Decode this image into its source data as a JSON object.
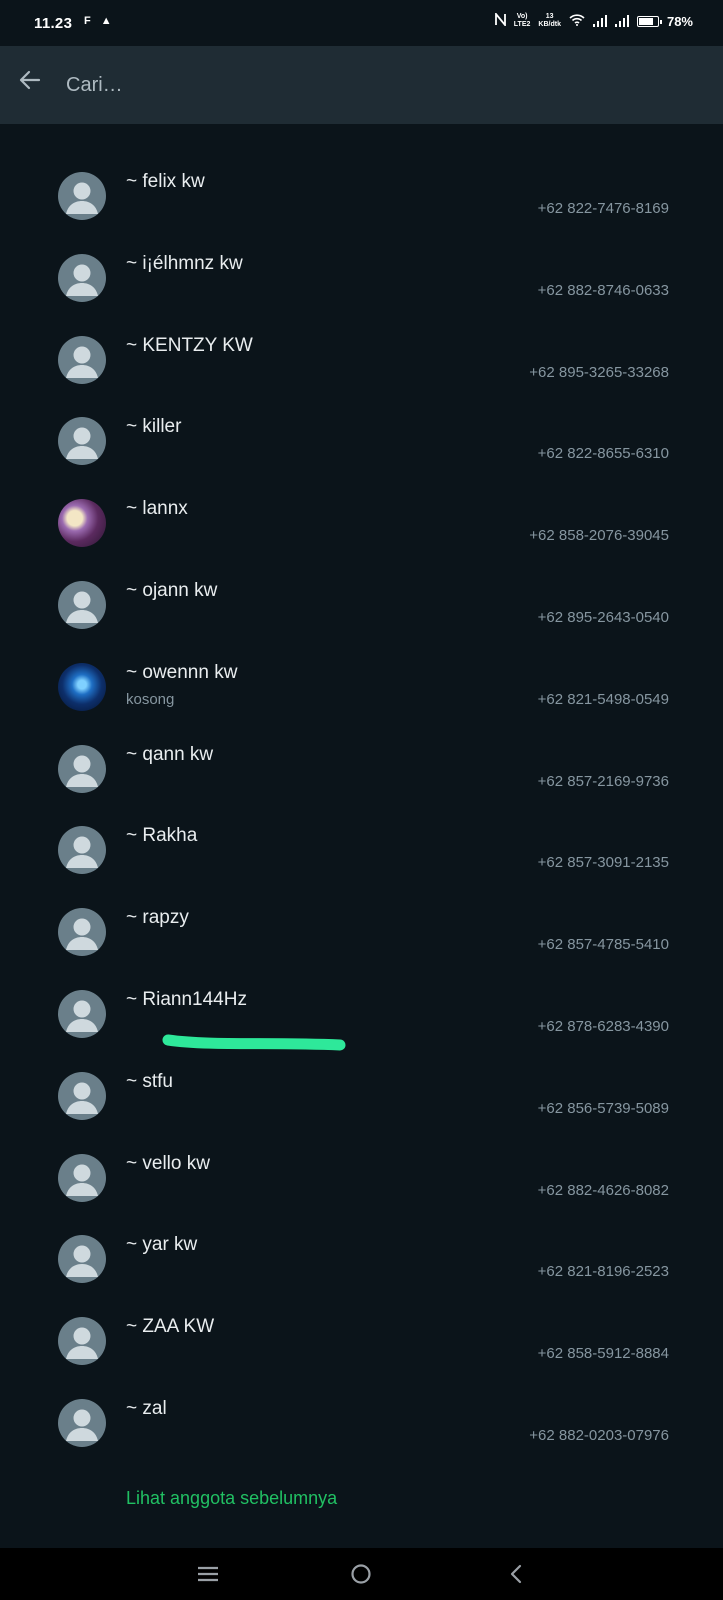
{
  "status_bar": {
    "time": "11.23",
    "left_icons": [
      "F",
      "▲"
    ],
    "net_top": "Vo)",
    "net_bottom": "LTE2",
    "speed_top": "13",
    "speed_bottom": "KB/dtk",
    "battery_percent": "78%"
  },
  "search": {
    "placeholder": "Cari…",
    "value": ""
  },
  "contacts": [
    {
      "name": "~ felix kw",
      "about": "",
      "phone": "+62 822-7476-8169",
      "avatar": "default"
    },
    {
      "name": "~ i¡élhmnz kw",
      "about": "",
      "phone": "+62 882-8746-0633",
      "avatar": "default"
    },
    {
      "name": "~ KENTZY KW",
      "about": "",
      "phone": "+62 895-3265-33268",
      "avatar": "default"
    },
    {
      "name": "~ killer",
      "about": "",
      "phone": "+62 822-8655-6310",
      "avatar": "default"
    },
    {
      "name": "~ lannx",
      "about": "",
      "phone": "+62 858-2076-39045",
      "avatar": "photo-a"
    },
    {
      "name": "~ ojann kw",
      "about": "",
      "phone": "+62 895-2643-0540",
      "avatar": "default"
    },
    {
      "name": "~ owennn kw",
      "about": "kosong",
      "phone": "+62 821-5498-0549",
      "avatar": "photo-b"
    },
    {
      "name": "~ qann kw",
      "about": "",
      "phone": "+62 857-2169-9736",
      "avatar": "default"
    },
    {
      "name": "~ Rakha",
      "about": "",
      "phone": "+62 857-3091-2135",
      "avatar": "default"
    },
    {
      "name": "~ rapzy",
      "about": "",
      "phone": "+62 857-4785-5410",
      "avatar": "default"
    },
    {
      "name": "~ Riann144Hz",
      "about": "",
      "phone": "+62 878-6283-4390",
      "avatar": "default"
    },
    {
      "name": "~ stfu",
      "about": "",
      "phone": "+62 856-5739-5089",
      "avatar": "default"
    },
    {
      "name": "~ vello kw",
      "about": "",
      "phone": "+62 882-4626-8082",
      "avatar": "default"
    },
    {
      "name": "~ yar kw",
      "about": "",
      "phone": "+62 821-8196-2523",
      "avatar": "default"
    },
    {
      "name": "~ ZAA KW",
      "about": "",
      "phone": "+62 858-5912-8884",
      "avatar": "default"
    },
    {
      "name": "~ zal",
      "about": "",
      "phone": "+62 882-0203-07976",
      "avatar": "default"
    }
  ],
  "footer_link": "Lihat anggota sebelumnya",
  "colors": {
    "background": "#0b141a",
    "header": "#1f2c34",
    "accent_green": "#21c063",
    "highlight_stroke": "#2ee89a",
    "secondary_text": "#8696a0"
  },
  "nav_bar": {
    "icons": [
      "menu-icon",
      "home-circle-icon",
      "back-chevron-icon"
    ]
  }
}
